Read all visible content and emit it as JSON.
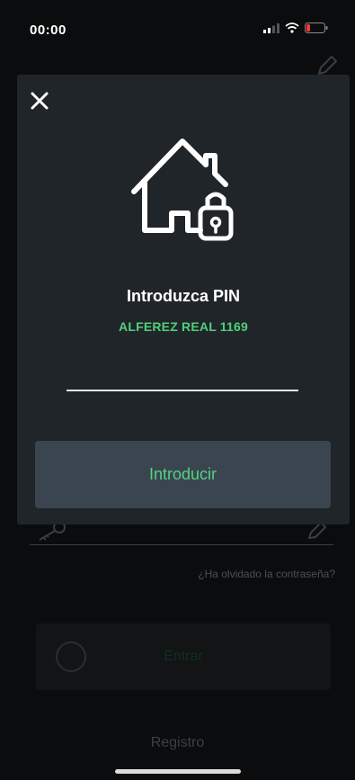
{
  "status_bar": {
    "time": "00:00"
  },
  "background": {
    "forgot_password": "¿Ha olvidado la contraseña?",
    "enter_label": "Entrar",
    "register_label": "Registro"
  },
  "modal": {
    "title": "Introduzca PIN",
    "subtitle": "ALFEREZ REAL 1169",
    "pin_value": "",
    "submit_label": "Introducir"
  },
  "colors": {
    "accent_green": "#4fd07a",
    "modal_bg": "#202529",
    "button_bg": "#3b4550",
    "battery_low": "#ff3b30"
  },
  "icons": {
    "close": "close-icon",
    "house": "house-lock-icon",
    "key": "key-icon",
    "pencil": "pencil-icon"
  }
}
